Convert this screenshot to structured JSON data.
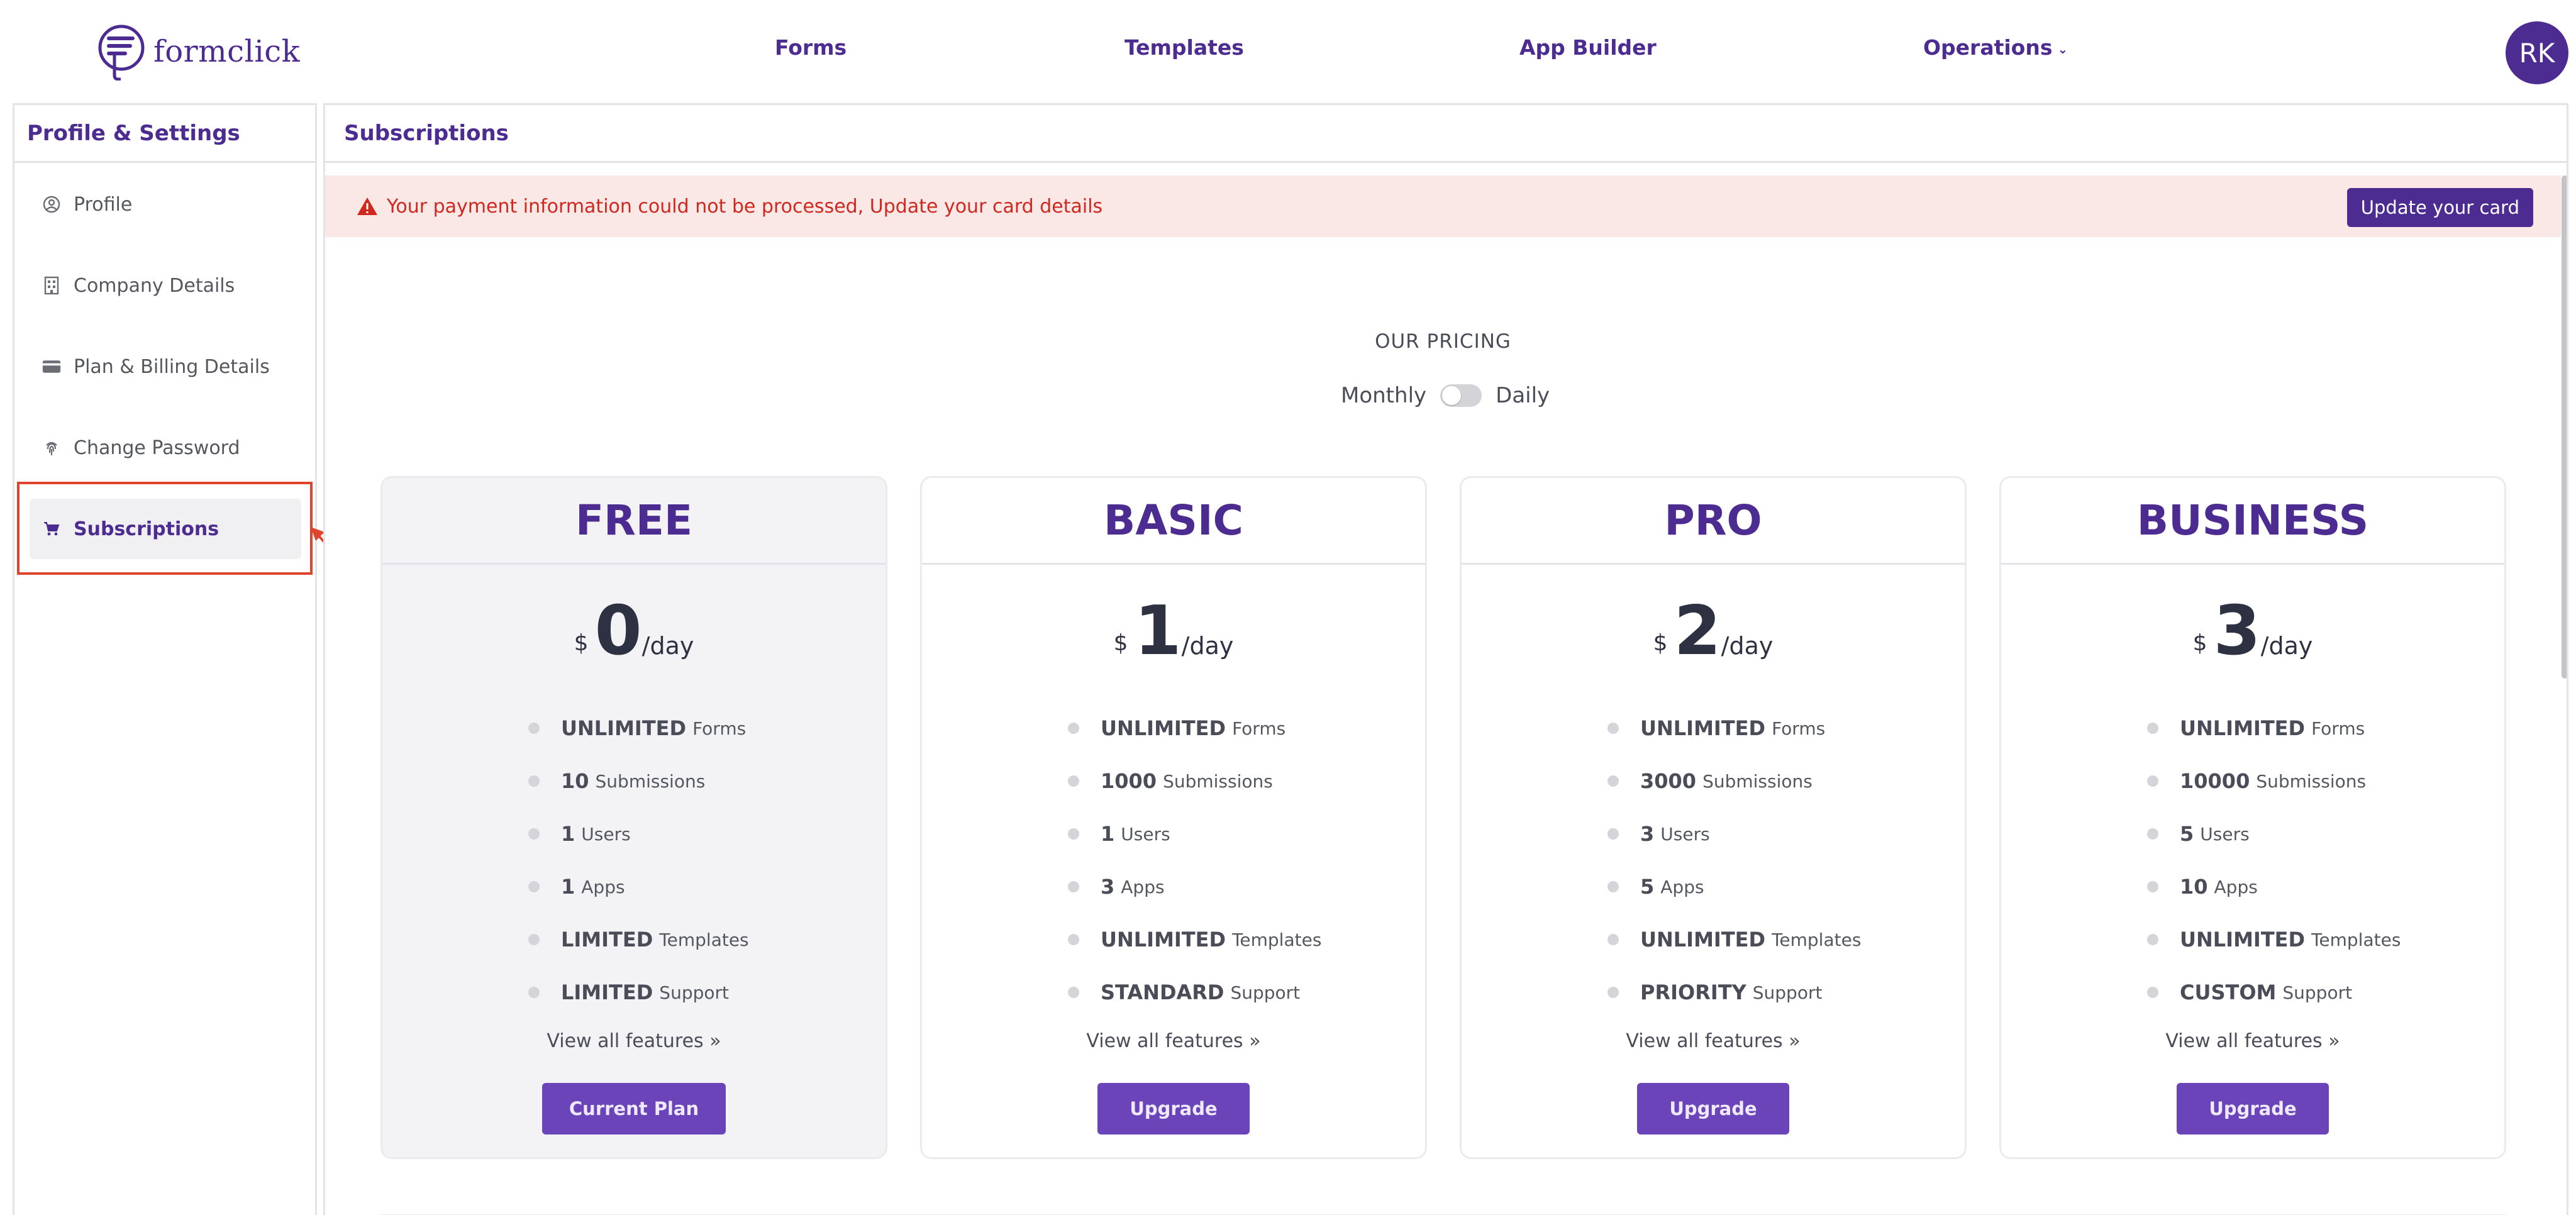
{
  "brand": {
    "logo_text": "formclick",
    "logo_icon": "formclick-logo-icon"
  },
  "nav": {
    "forms": "Forms",
    "templates": "Templates",
    "app_builder": "App Builder",
    "operations": "Operations",
    "operations_chevron": "⌄"
  },
  "user": {
    "initials": "RK"
  },
  "sidebar": {
    "title": "Profile & Settings",
    "items": [
      {
        "label": "Profile",
        "icon": "user-circle-icon"
      },
      {
        "label": "Company Details",
        "icon": "building-icon"
      },
      {
        "label": "Plan & Billing Details",
        "icon": "credit-card-icon"
      },
      {
        "label": "Change Password",
        "icon": "fingerprint-icon"
      },
      {
        "label": "Subscriptions",
        "icon": "cart-icon",
        "active": true
      }
    ]
  },
  "main": {
    "title": "Subscriptions",
    "alert": {
      "message": "Your payment information could not be processed, Update your card details",
      "button": "Update your card"
    },
    "pricing_heading": "OUR PRICING",
    "toggle": {
      "left_label": "Monthly",
      "right_label": "Daily"
    }
  },
  "plans": [
    {
      "name": "FREE",
      "currency": "$",
      "price": "0",
      "period": "/day",
      "features": [
        {
          "q": "UNLIMITED",
          "l": "Forms"
        },
        {
          "q": "10",
          "l": "Submissions"
        },
        {
          "q": "1",
          "l": "Users"
        },
        {
          "q": "1",
          "l": "Apps"
        },
        {
          "q": "LIMITED",
          "l": "Templates"
        },
        {
          "q": "LIMITED",
          "l": "Support"
        }
      ],
      "view_all": "View all features »",
      "button": "Current Plan"
    },
    {
      "name": "BASIC",
      "currency": "$",
      "price": "1",
      "period": "/day",
      "features": [
        {
          "q": "UNLIMITED",
          "l": "Forms"
        },
        {
          "q": "1000",
          "l": "Submissions"
        },
        {
          "q": "1",
          "l": "Users"
        },
        {
          "q": "3",
          "l": "Apps"
        },
        {
          "q": "UNLIMITED",
          "l": "Templates"
        },
        {
          "q": "STANDARD",
          "l": "Support"
        }
      ],
      "view_all": "View all features »",
      "button": "Upgrade"
    },
    {
      "name": "PRO",
      "currency": "$",
      "price": "2",
      "period": "/day",
      "features": [
        {
          "q": "UNLIMITED",
          "l": "Forms"
        },
        {
          "q": "3000",
          "l": "Submissions"
        },
        {
          "q": "3",
          "l": "Users"
        },
        {
          "q": "5",
          "l": "Apps"
        },
        {
          "q": "UNLIMITED",
          "l": "Templates"
        },
        {
          "q": "PRIORITY",
          "l": "Support"
        }
      ],
      "view_all": "View all features »",
      "button": "Upgrade"
    },
    {
      "name": "BUSINESS",
      "currency": "$",
      "price": "3",
      "period": "/day",
      "features": [
        {
          "q": "UNLIMITED",
          "l": "Forms"
        },
        {
          "q": "10000",
          "l": "Submissions"
        },
        {
          "q": "5",
          "l": "Users"
        },
        {
          "q": "10",
          "l": "Apps"
        },
        {
          "q": "UNLIMITED",
          "l": "Templates"
        },
        {
          "q": "CUSTOM",
          "l": "Support"
        }
      ],
      "view_all": "View all features »",
      "button": "Upgrade"
    }
  ],
  "colors": {
    "brand": "#4d2c91",
    "button": "#6a44b8",
    "alert_bg": "#f9e8e6",
    "alert_text": "#d0271e",
    "annotation": "#e0442d"
  }
}
